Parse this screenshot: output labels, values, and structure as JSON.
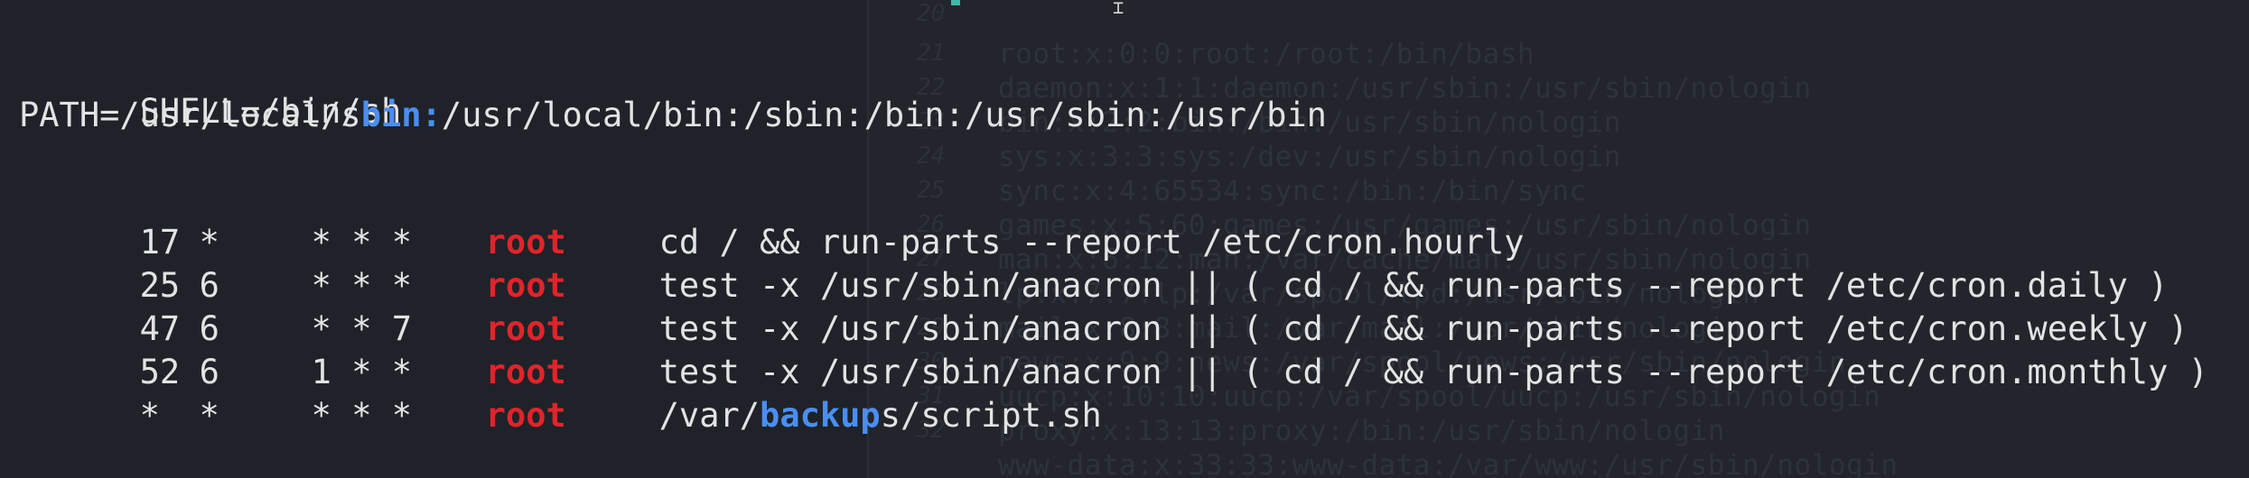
{
  "env": {
    "shell": "SHELL=/bin/sh",
    "path_pre": "PATH=/usr/local/s",
    "path_hl": "bin:",
    "path_post": "/usr/local/bin:/sbin:/bin:/usr/sbin:/usr/bin"
  },
  "jobs": [
    {
      "minute": "17",
      "hour": "*",
      "dom_mon_dow": "* * *",
      "user": "root",
      "command": "cd / && run-parts --report /etc/cron.hourly"
    },
    {
      "minute": "25",
      "hour": "6",
      "dom_mon_dow": "* * *",
      "user": "root",
      "command": "test -x /usr/sbin/anacron || ( cd / && run-parts --report /etc/cron.daily )"
    },
    {
      "minute": "47",
      "hour": "6",
      "dom_mon_dow": "* * 7",
      "user": "root",
      "command": "test -x /usr/sbin/anacron || ( cd / && run-parts --report /etc/cron.weekly )"
    },
    {
      "minute": "52",
      "hour": "6",
      "dom_mon_dow": "1 * *",
      "user": "root",
      "command": "test -x /usr/sbin/anacron || ( cd / && run-parts --report /etc/cron.monthly )"
    },
    {
      "minute": "*",
      "hour": "*",
      "dom_mon_dow": "* * *",
      "user": "root",
      "command_pre": "/var/",
      "command_hl": "backup",
      "command_post": "s/script.sh"
    }
  ],
  "background_pane": {
    "line_numbers": [
      "20",
      "21",
      "22",
      "23",
      "24",
      "25",
      "26",
      "27",
      "28",
      "29",
      "30",
      "31",
      "32",
      "33",
      "34"
    ],
    "lines": [
      "root:x:0:0:root:/root:/bin/bash",
      "daemon:x:1:1:daemon:/usr/sbin:/usr/sbin/nologin",
      "bin:x:2:2:bin:/bin:/usr/sbin/nologin",
      "sys:x:3:3:sys:/dev:/usr/sbin/nologin",
      "sync:x:4:65534:sync:/bin:/bin/sync",
      "games:x:5:60:games:/usr/games:/usr/sbin/nologin",
      "man:x:6:12:man:/var/cache/man:/usr/sbin/nologin",
      "lp:x:7:7:lp:/var/spool/lpd:/usr/sbin/nologin",
      "mail:x:8:8:mail:/var/mail:/usr/sbin/nologin",
      "news:x:9:9:news:/var/spool/news:/usr/sbin/nologin",
      "uucp:x:10:10:uucp:/var/spool/uucp:/usr/sbin/nologin",
      "proxy:x:13:13:proxy:/bin:/usr/sbin/nologin",
      "www-data:x:33:33:www-data:/var/www:/usr/sbin/nologin"
    ]
  }
}
